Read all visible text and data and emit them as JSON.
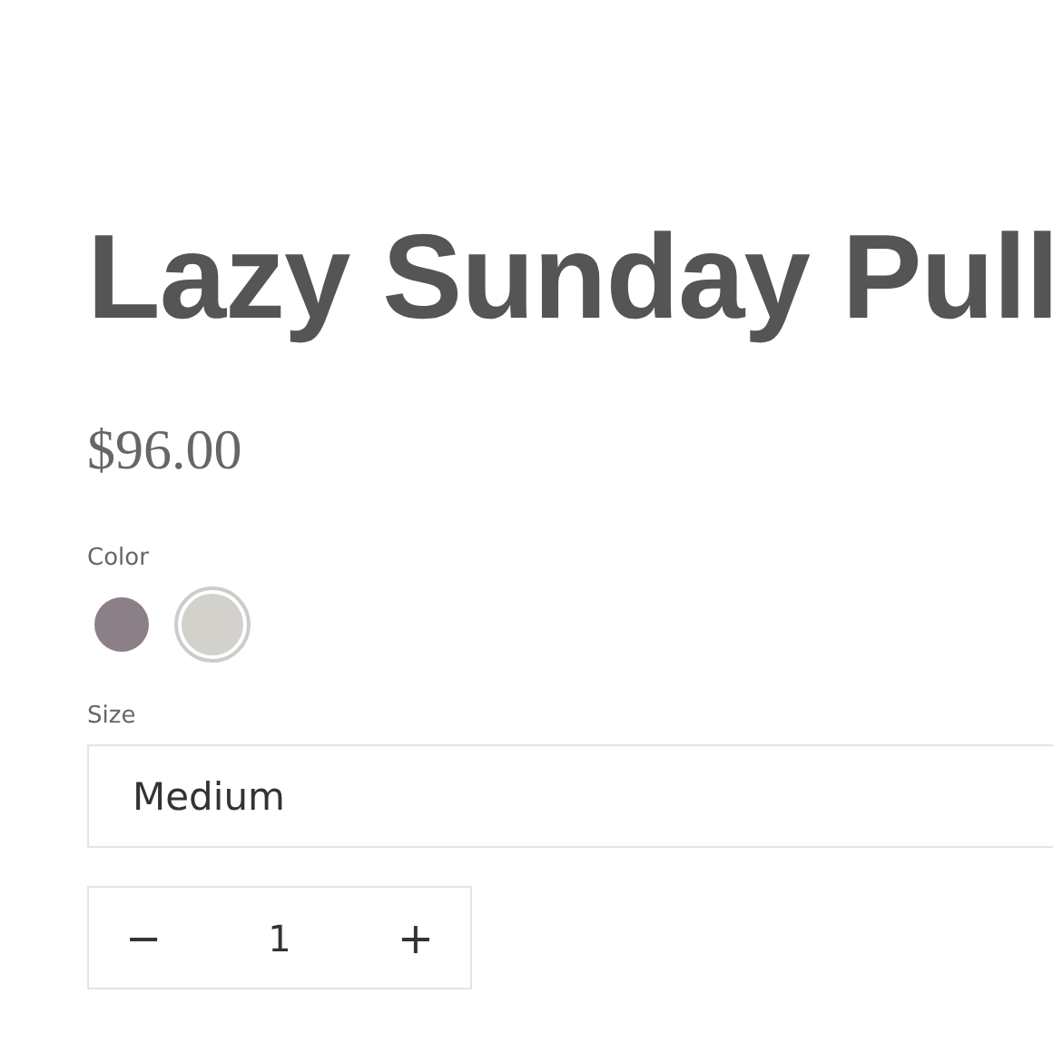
{
  "product": {
    "title": "Lazy Sunday Pull",
    "price": "$96.00"
  },
  "color_option": {
    "label": "Color",
    "swatches": [
      {
        "color": "#8b8087",
        "selected": false
      },
      {
        "color": "#d3d1cb",
        "selected": true
      }
    ]
  },
  "size_option": {
    "label": "Size",
    "value": "Medium"
  },
  "quantity": {
    "decrease": "−",
    "value": "1",
    "increase": "+"
  }
}
